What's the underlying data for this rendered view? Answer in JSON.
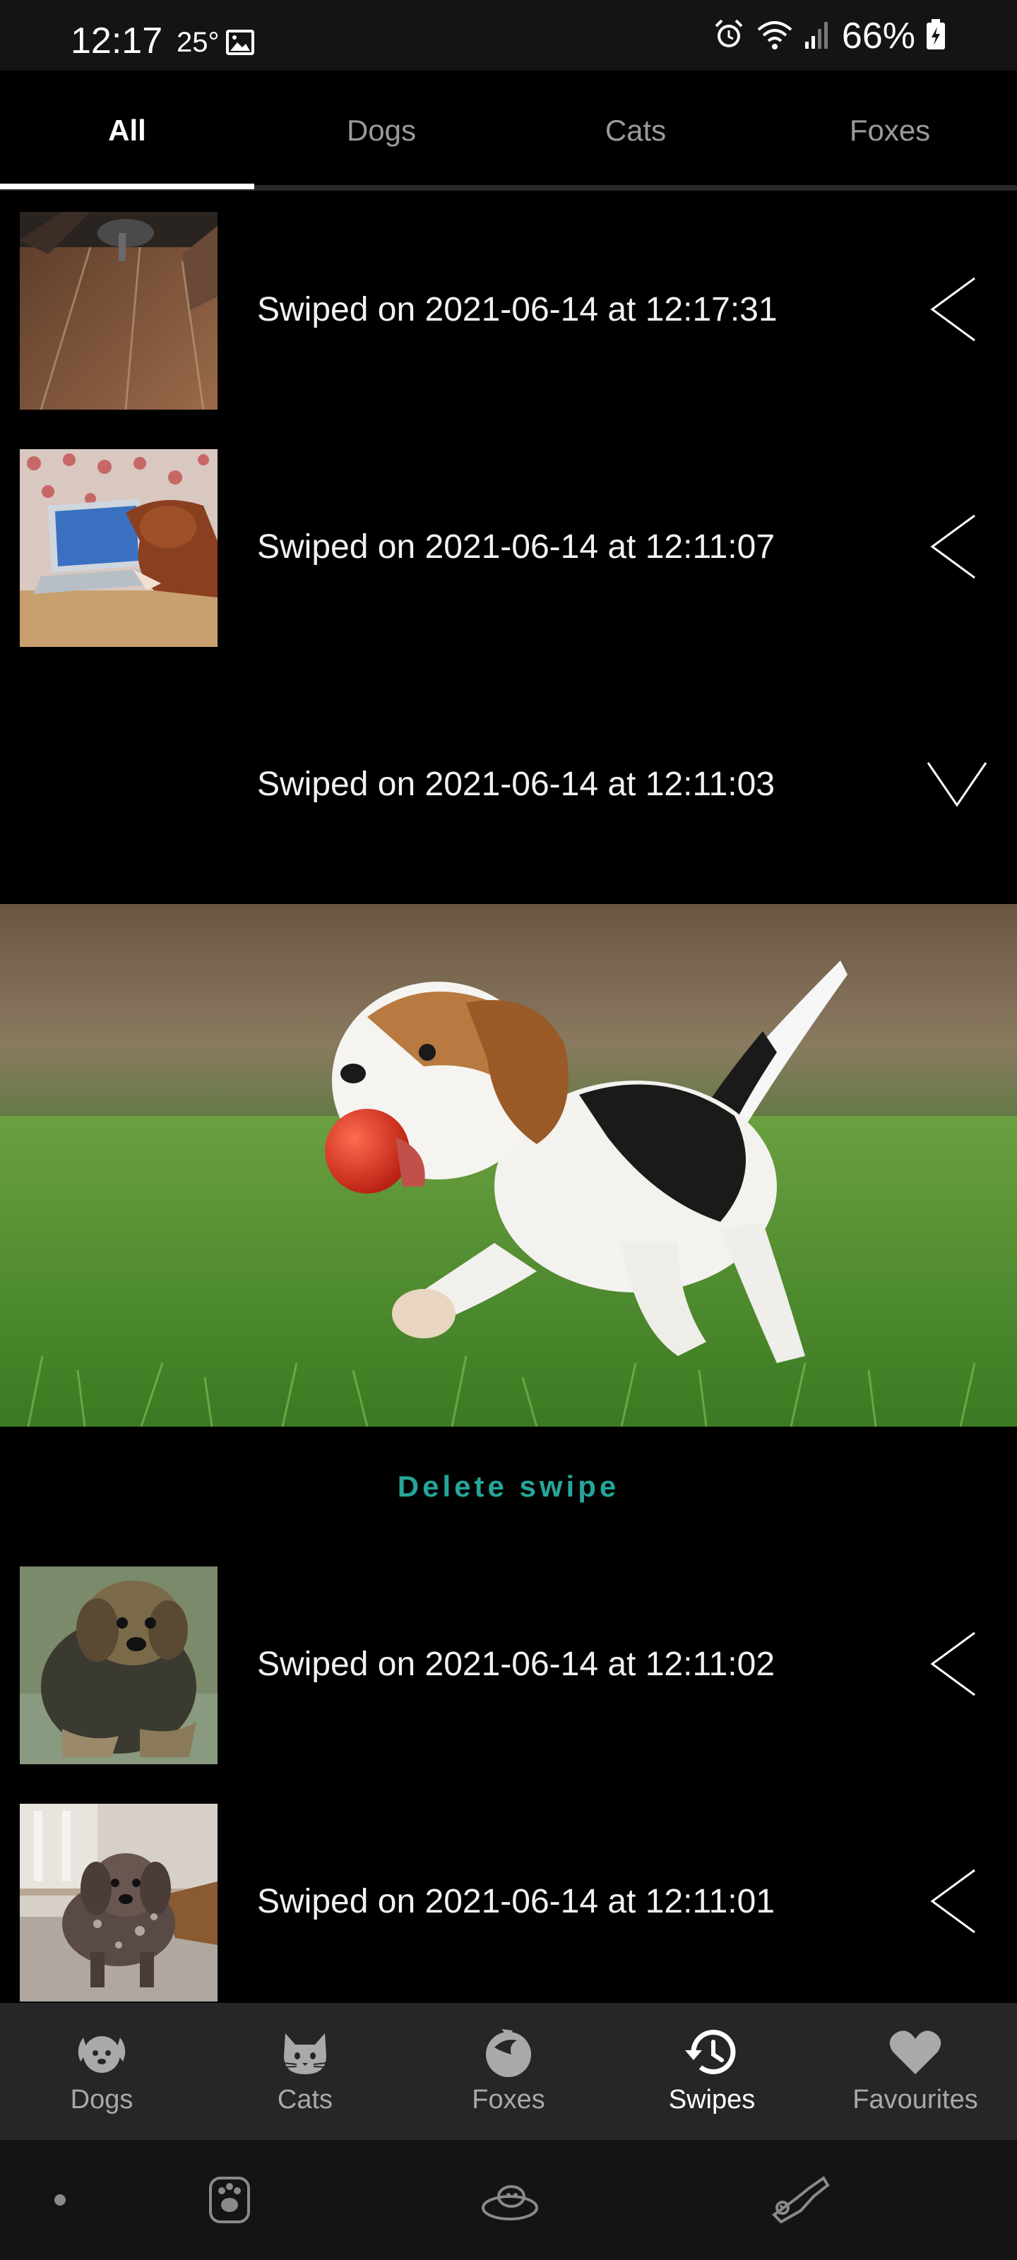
{
  "status_bar": {
    "time": "12:17",
    "temperature": "25°",
    "battery": "66%",
    "icons": [
      "gallery-icon",
      "alarm-icon",
      "wifi-icon",
      "signal-icon",
      "battery-icon"
    ]
  },
  "tabs": [
    {
      "label": "All",
      "active": true
    },
    {
      "label": "Dogs",
      "active": false
    },
    {
      "label": "Cats",
      "active": false
    },
    {
      "label": "Foxes",
      "active": false
    }
  ],
  "swipes": [
    {
      "text": "Swiped on 2021-06-14 at 12:17:31",
      "chevron": "chevron-left-icon"
    },
    {
      "text": "Swiped on 2021-06-14 at 12:11:07",
      "chevron": "chevron-left-icon"
    },
    {
      "text": "Swiped on 2021-06-14 at 12:11:03",
      "chevron": "chevron-down-icon",
      "expanded": true
    },
    {
      "text": "Swiped on 2021-06-14 at 12:11:02",
      "chevron": "chevron-left-icon"
    },
    {
      "text": "Swiped on 2021-06-14 at 12:11:01",
      "chevron": "chevron-left-icon"
    }
  ],
  "expanded": {
    "delete_label": "Delete swipe"
  },
  "bottom_nav": [
    {
      "label": "Dogs",
      "icon": "dog-icon",
      "active": false
    },
    {
      "label": "Cats",
      "icon": "cat-icon",
      "active": false
    },
    {
      "label": "Foxes",
      "icon": "fox-icon",
      "active": false
    },
    {
      "label": "Swipes",
      "icon": "history-icon",
      "active": true
    },
    {
      "label": "Favourites",
      "icon": "heart-icon",
      "active": false
    }
  ],
  "system_bar": {
    "icons": [
      "dot-icon",
      "paw-icon",
      "pet-bed-icon",
      "dog-pet-icon"
    ]
  },
  "colors": {
    "accent": "#26a69a",
    "background": "#000000",
    "nav_background": "#262626",
    "status_background": "#141414"
  }
}
